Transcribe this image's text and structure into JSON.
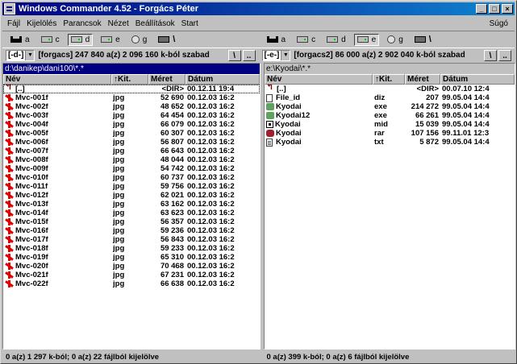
{
  "window": {
    "title": "Windows Commander 4.52 - Forgács Péter",
    "controls": [
      "_",
      "□",
      "×"
    ]
  },
  "menu": {
    "items": [
      "Fájl",
      "Kijelölés",
      "Parancsok",
      "Nézet",
      "Beállítások",
      "Start"
    ],
    "help": "Súgó"
  },
  "drivebar": {
    "left": [
      {
        "label": "a",
        "icon": "floppy",
        "pressed": false
      },
      {
        "label": "c",
        "icon": "hd",
        "pressed": false
      },
      {
        "label": "d",
        "icon": "hd",
        "pressed": true
      },
      {
        "label": "e",
        "icon": "hd",
        "pressed": false
      },
      {
        "label": "g",
        "icon": "cd",
        "pressed": false
      },
      {
        "label": "\\",
        "icon": "net",
        "pressed": false
      }
    ],
    "right": [
      {
        "label": "a",
        "icon": "floppy",
        "pressed": false
      },
      {
        "label": "c",
        "icon": "hd",
        "pressed": false
      },
      {
        "label": "d",
        "icon": "hd",
        "pressed": false
      },
      {
        "label": "e",
        "icon": "hd",
        "pressed": true
      },
      {
        "label": "g",
        "icon": "cd",
        "pressed": false
      },
      {
        "label": "\\",
        "icon": "net",
        "pressed": false
      }
    ]
  },
  "infobar": {
    "left": {
      "drive": "[-d-]",
      "arrow": "▼",
      "text": "[forgacs]  247 840 a(z) 2 096 160 k-ból szabad",
      "btn1": "\\",
      "btn2": ".."
    },
    "right": {
      "drive": "[-e-]",
      "arrow": "▼",
      "text": "[forgacs2]  86 000 a(z) 2 902 040 k-ból szabad",
      "btn1": "\\",
      "btn2": ".."
    }
  },
  "left_panel": {
    "path": "d:\\danikep\\dani100\\*.*",
    "columns": {
      "name": "Név",
      "ext": "↑Kit.",
      "size": "Méret",
      "date": "Dátum"
    },
    "rows": [
      {
        "name": "[..]",
        "ext": "",
        "size": "<DIR>",
        "date": "00.12.11 19:4",
        "icon": "updir"
      },
      {
        "name": "Mvc-001f",
        "ext": "jpg",
        "size": "52 690",
        "date": "00.12.03 16:2",
        "icon": "jpg"
      },
      {
        "name": "Mvc-002f",
        "ext": "jpg",
        "size": "48 652",
        "date": "00.12.03 16:2",
        "icon": "jpg"
      },
      {
        "name": "Mvc-003f",
        "ext": "jpg",
        "size": "64 454",
        "date": "00.12.03 16:2",
        "icon": "jpg"
      },
      {
        "name": "Mvc-004f",
        "ext": "jpg",
        "size": "66 079",
        "date": "00.12.03 16:2",
        "icon": "jpg"
      },
      {
        "name": "Mvc-005f",
        "ext": "jpg",
        "size": "60 307",
        "date": "00.12.03 16:2",
        "icon": "jpg"
      },
      {
        "name": "Mvc-006f",
        "ext": "jpg",
        "size": "56 807",
        "date": "00.12.03 16:2",
        "icon": "jpg"
      },
      {
        "name": "Mvc-007f",
        "ext": "jpg",
        "size": "66 643",
        "date": "00.12.03 16:2",
        "icon": "jpg"
      },
      {
        "name": "Mvc-008f",
        "ext": "jpg",
        "size": "48 044",
        "date": "00.12.03 16:2",
        "icon": "jpg"
      },
      {
        "name": "Mvc-009f",
        "ext": "jpg",
        "size": "54 742",
        "date": "00.12.03 16:2",
        "icon": "jpg"
      },
      {
        "name": "Mvc-010f",
        "ext": "jpg",
        "size": "60 737",
        "date": "00.12.03 16:2",
        "icon": "jpg"
      },
      {
        "name": "Mvc-011f",
        "ext": "jpg",
        "size": "59 756",
        "date": "00.12.03 16:2",
        "icon": "jpg"
      },
      {
        "name": "Mvc-012f",
        "ext": "jpg",
        "size": "62 021",
        "date": "00.12.03 16:2",
        "icon": "jpg"
      },
      {
        "name": "Mvc-013f",
        "ext": "jpg",
        "size": "63 162",
        "date": "00.12.03 16:2",
        "icon": "jpg"
      },
      {
        "name": "Mvc-014f",
        "ext": "jpg",
        "size": "63 623",
        "date": "00.12.03 16:2",
        "icon": "jpg"
      },
      {
        "name": "Mvc-015f",
        "ext": "jpg",
        "size": "56 357",
        "date": "00.12.03 16:2",
        "icon": "jpg"
      },
      {
        "name": "Mvc-016f",
        "ext": "jpg",
        "size": "59 236",
        "date": "00.12.03 16:2",
        "icon": "jpg"
      },
      {
        "name": "Mvc-017f",
        "ext": "jpg",
        "size": "56 843",
        "date": "00.12.03 16:2",
        "icon": "jpg"
      },
      {
        "name": "Mvc-018f",
        "ext": "jpg",
        "size": "59 233",
        "date": "00.12.03 16:2",
        "icon": "jpg"
      },
      {
        "name": "Mvc-019f",
        "ext": "jpg",
        "size": "65 310",
        "date": "00.12.03 16:2",
        "icon": "jpg"
      },
      {
        "name": "Mvc-020f",
        "ext": "jpg",
        "size": "70 468",
        "date": "00.12.03 16:2",
        "icon": "jpg"
      },
      {
        "name": "Mvc-021f",
        "ext": "jpg",
        "size": "67 231",
        "date": "00.12.03 16:2",
        "icon": "jpg"
      },
      {
        "name": "Mvc-022f",
        "ext": "jpg",
        "size": "66 638",
        "date": "00.12.03 16:2",
        "icon": "jpg"
      }
    ]
  },
  "right_panel": {
    "path": "e:\\Kyodai\\*.*",
    "columns": {
      "name": "Név",
      "ext": "↑Kit.",
      "size": "Méret",
      "date": "Dátum"
    },
    "rows": [
      {
        "name": "[..]",
        "ext": "",
        "size": "<DIR>",
        "date": "00.07.10 12:4",
        "icon": "updir"
      },
      {
        "name": "File_id",
        "ext": "diz",
        "size": "207",
        "date": "99.05.04 14:4",
        "icon": "doc"
      },
      {
        "name": "Kyodai",
        "ext": "exe",
        "size": "214 272",
        "date": "99.05.04 14:4",
        "icon": "exe"
      },
      {
        "name": "Kyodai12",
        "ext": "exe",
        "size": "66 261",
        "date": "99.05.04 14:4",
        "icon": "exe"
      },
      {
        "name": "Kyodai",
        "ext": "mid",
        "size": "15 039",
        "date": "99.05.04 14:4",
        "icon": "mid"
      },
      {
        "name": "Kyodai",
        "ext": "rar",
        "size": "107 156",
        "date": "99.11.01 12:3",
        "icon": "rar"
      },
      {
        "name": "Kyodai",
        "ext": "txt",
        "size": "5 872",
        "date": "99.05.04 14:4",
        "icon": "txt"
      }
    ]
  },
  "status": {
    "left": "0 a(z) 1 297 k-ból; 0 a(z) 22 fájlból kijelölve",
    "right": "0 a(z) 399 k-ból; 0 a(z) 6 fájlból kijelölve"
  }
}
